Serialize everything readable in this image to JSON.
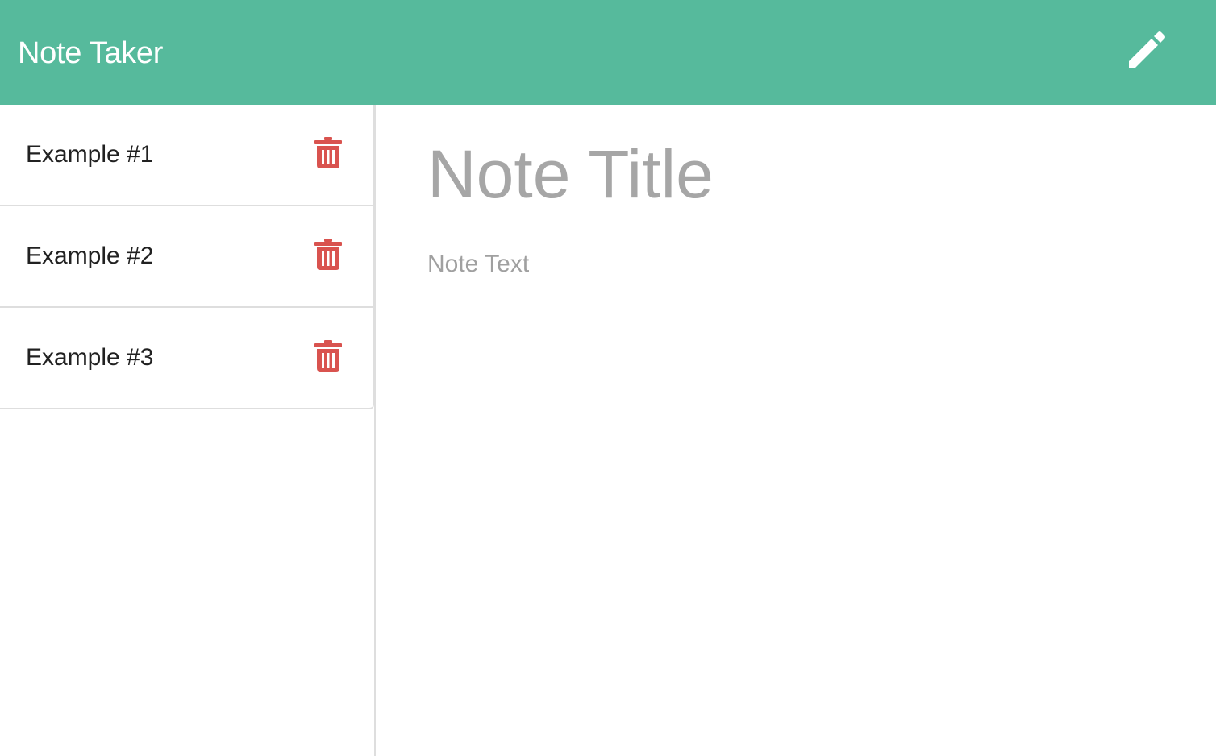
{
  "navbar": {
    "brand": "Note Taker",
    "new_note_icon": "pencil-icon"
  },
  "notes": [
    {
      "title": "Example #1",
      "delete_icon": "trash-icon"
    },
    {
      "title": "Example #2",
      "delete_icon": "trash-icon"
    },
    {
      "title": "Example #3",
      "delete_icon": "trash-icon"
    }
  ],
  "editor": {
    "title_placeholder": "Note Title",
    "text_placeholder": "Note Text"
  },
  "colors": {
    "navbar_bg": "#56ba9c",
    "delete_icon": "#d9534f",
    "placeholder": "#a6a6a6"
  }
}
